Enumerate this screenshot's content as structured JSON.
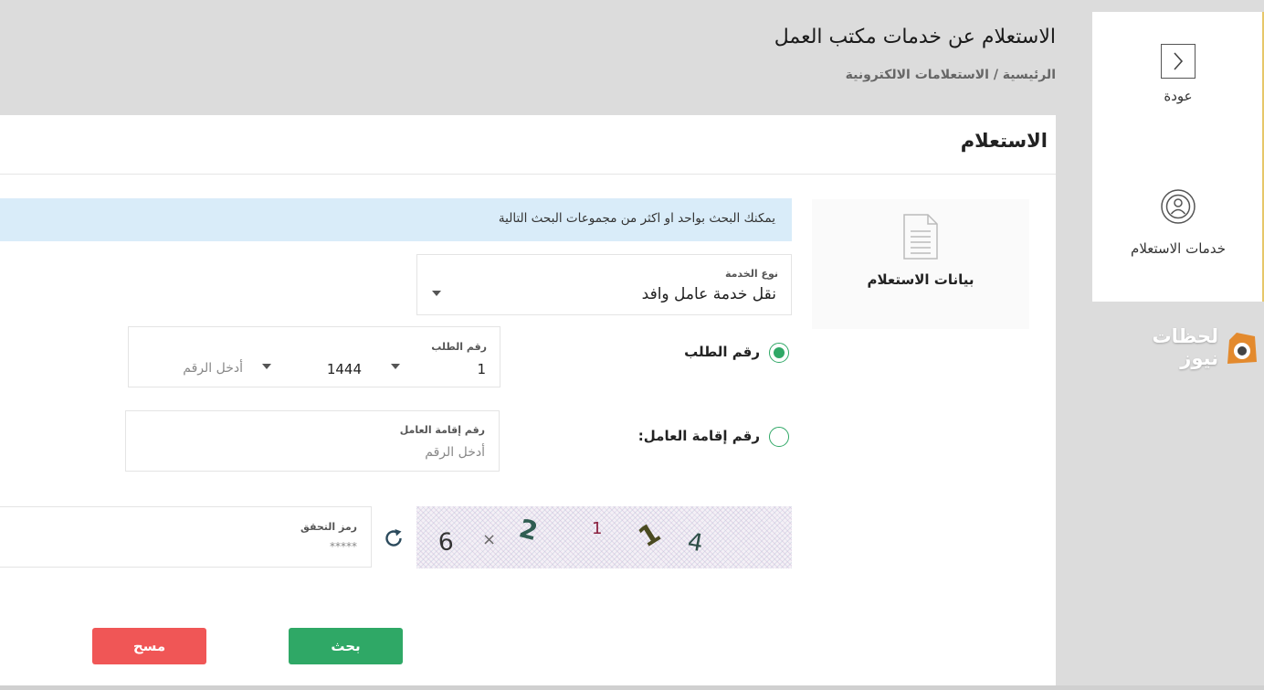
{
  "sidebar": {
    "back_label": "عودة",
    "services_label": "خدمات الاستعلام",
    "accent_color": "#e6c76a"
  },
  "watermark": {
    "text": "لحظات نيوز"
  },
  "header": {
    "title": "الاستعلام عن خدمات مكتب العمل",
    "breadcrumb": "الرئيسية / الاستعلامات الالكترونية"
  },
  "main": {
    "title": "الاستعلام",
    "section_label": "بيانات الاستعلام",
    "info_text": "يمكنك البحث بواحد او اكثر من مجموعات البحث التالية",
    "service_type": {
      "label": "نوع الخدمة",
      "value": "نقل خدمة عامل وافد"
    },
    "request_option": {
      "label": "رقم الطلب",
      "selected": true,
      "field_label": "رقم الطلب",
      "prefix_value": "1",
      "year_value": "1444",
      "number_placeholder": "أدخل الرقم"
    },
    "iqama_option": {
      "label": "رقم إقامة العامل:",
      "selected": false,
      "field_label": "رقم إقامة العامل",
      "placeholder": "أدخل الرقم"
    },
    "captcha": {
      "field_label": "رمز التحقق",
      "placeholder": "*****",
      "chars": [
        "6",
        "×",
        "2",
        "1",
        "1",
        "4"
      ]
    },
    "buttons": {
      "search": "بحث",
      "clear": "مسح"
    },
    "colors": {
      "primary": "#2fa866",
      "danger": "#f05656",
      "info_bg": "#d9ecf9"
    }
  }
}
